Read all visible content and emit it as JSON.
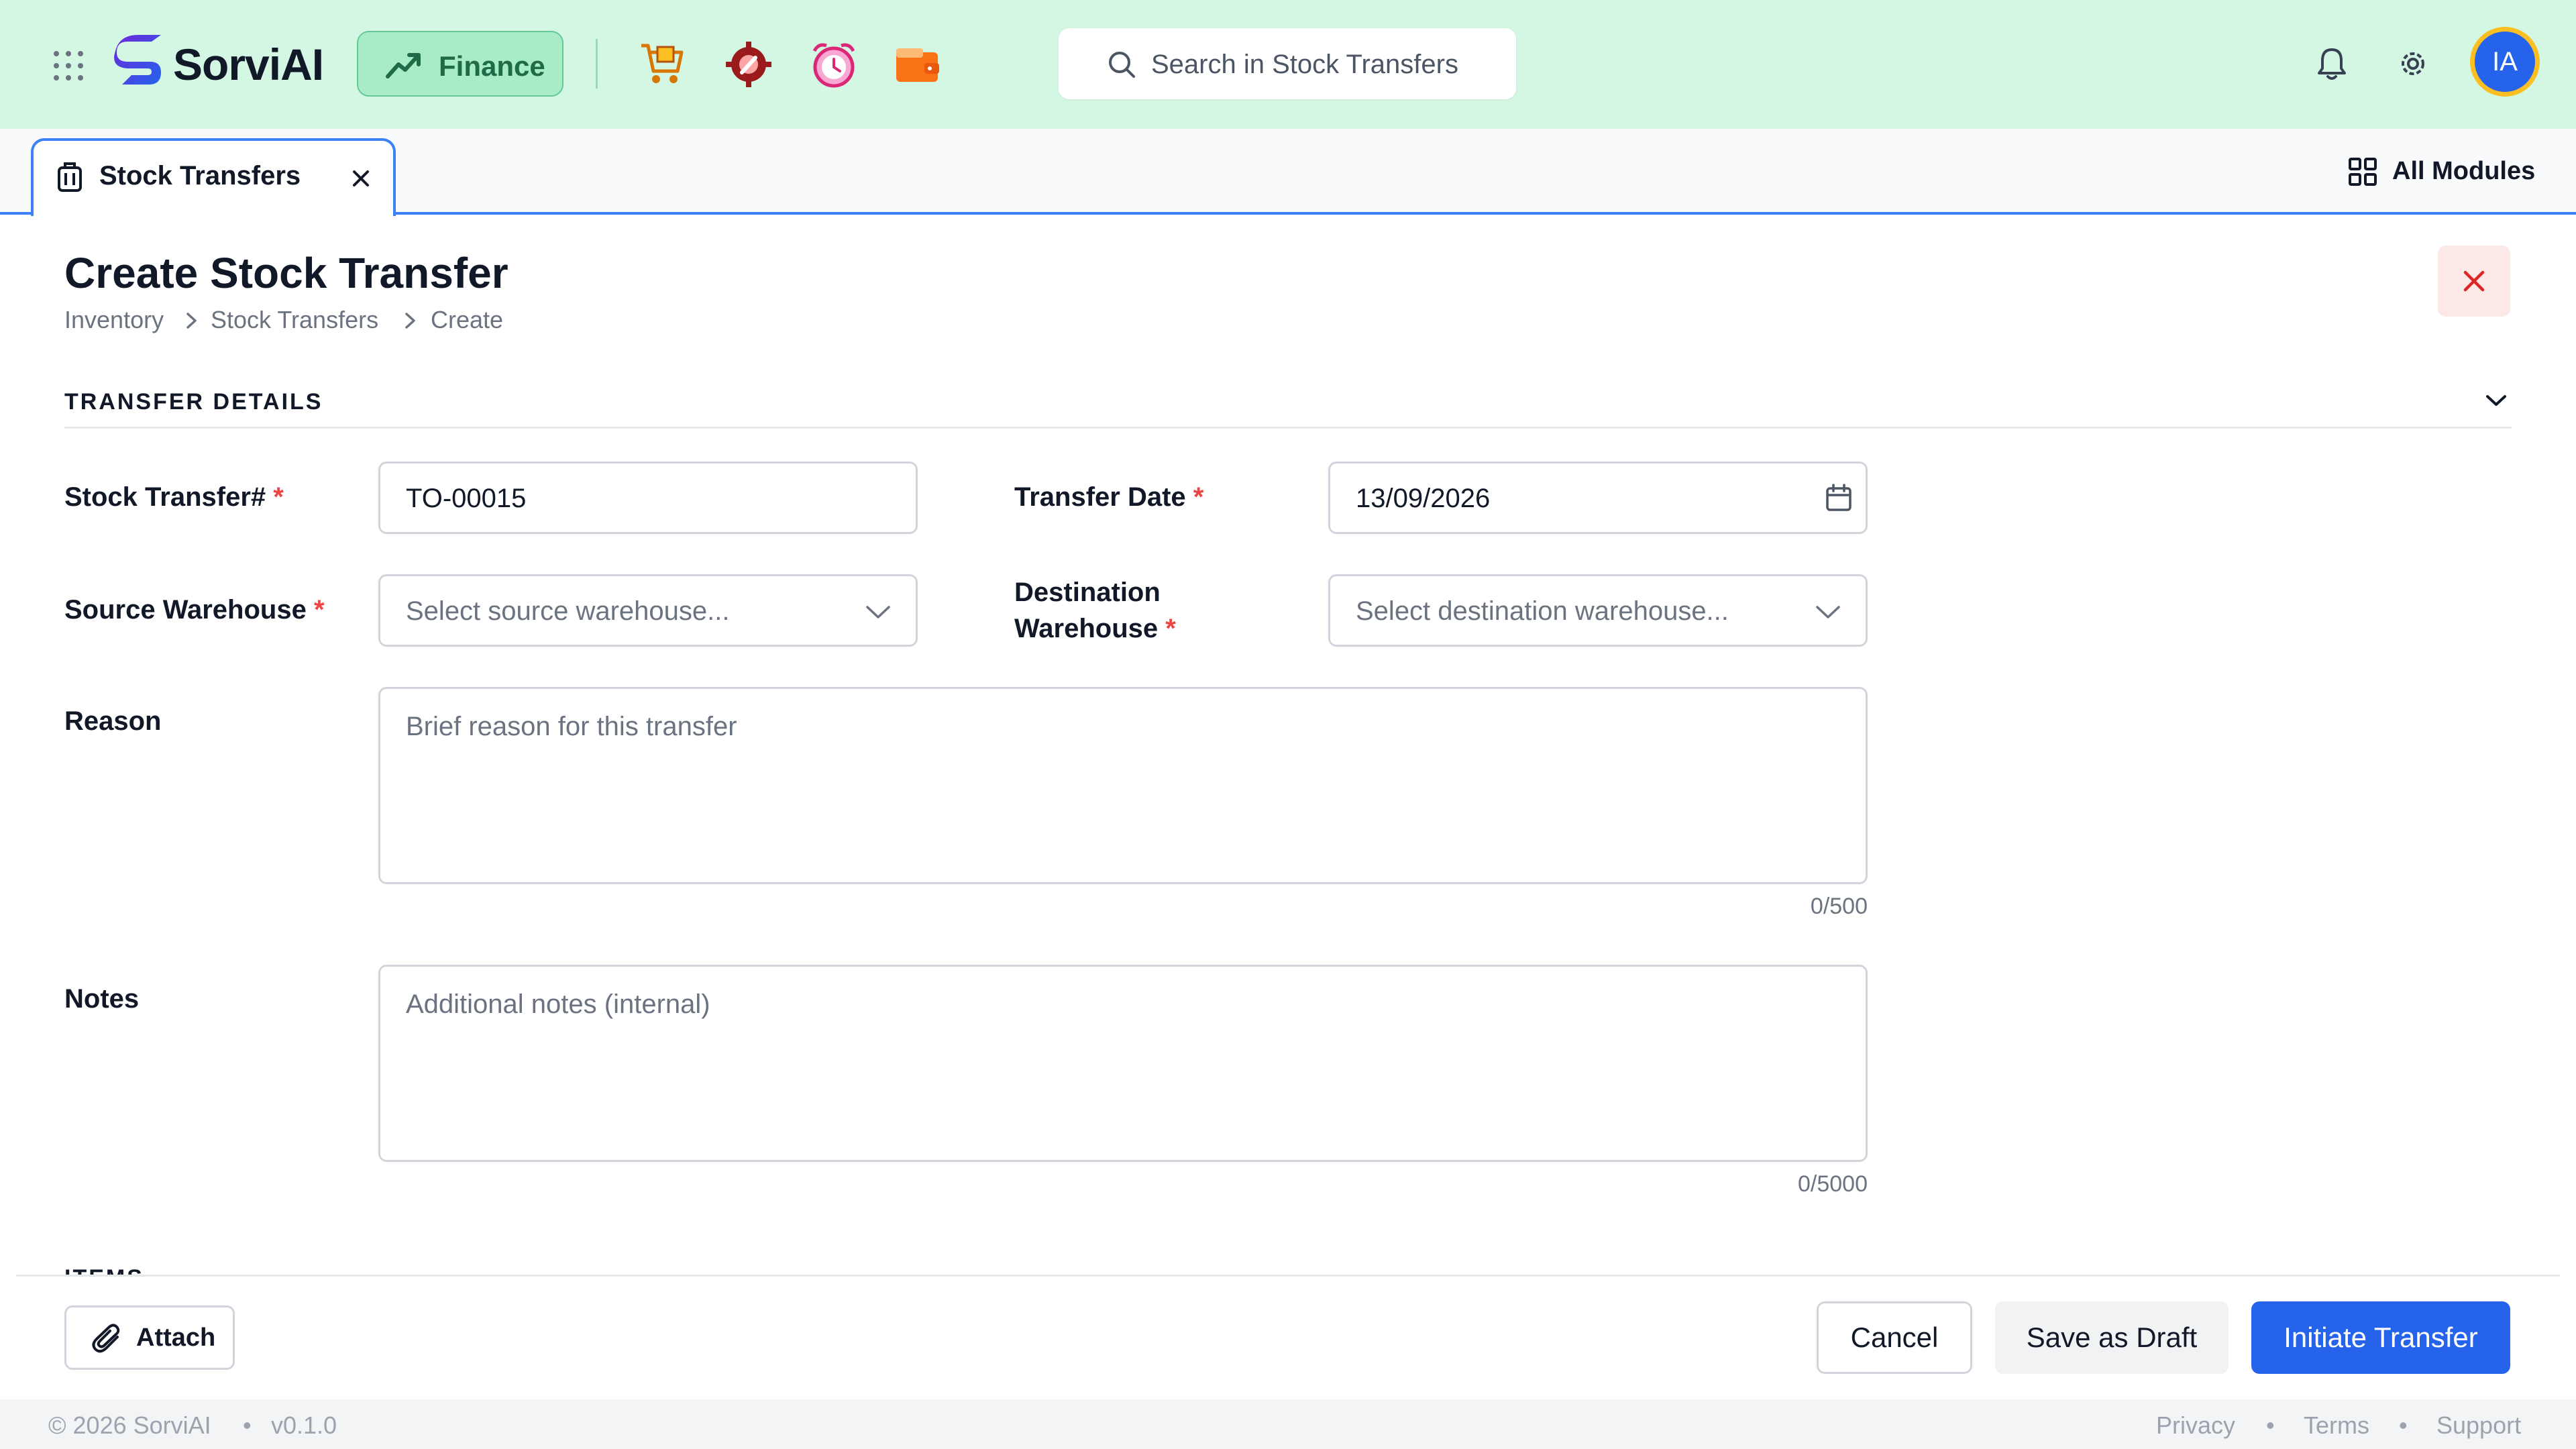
{
  "header": {
    "brand": "SorviAI",
    "module": "Finance",
    "search_placeholder": "Search in Stock Transfers",
    "avatar_initials": "IA"
  },
  "tabs": {
    "active_tab": "Stock Transfers",
    "all_modules": "All Modules"
  },
  "page": {
    "title": "Create Stock Transfer",
    "breadcrumb": [
      "Inventory",
      "Stock Transfers",
      "Create"
    ]
  },
  "section": {
    "title": "TRANSFER DETAILS"
  },
  "form": {
    "stock_transfer_label": "Stock Transfer#",
    "stock_transfer_value": "TO-00015",
    "transfer_date_label": "Transfer Date",
    "transfer_date_value": "13/09/2026",
    "source_label": "Source Warehouse",
    "source_placeholder": "Select source warehouse...",
    "destination_label_line1": "Destination",
    "destination_label_line2": "Warehouse",
    "destination_placeholder": "Select destination warehouse...",
    "reason_label": "Reason",
    "reason_placeholder": "Brief reason for this transfer",
    "reason_counter": "0/500",
    "notes_label": "Notes",
    "notes_placeholder": "Additional notes (internal)",
    "notes_counter": "0/5000",
    "required_mark": "*"
  },
  "next_section": "ITEMS",
  "actions": {
    "attach": "Attach",
    "cancel": "Cancel",
    "save_draft": "Save as Draft",
    "initiate": "Initiate Transfer"
  },
  "footer": {
    "copyright": "© 2026 SorviAI",
    "version": "v0.1.0",
    "privacy": "Privacy",
    "terms": "Terms",
    "support": "Support",
    "separator": "•"
  },
  "colors": {
    "header_bg": "#d4f7e3",
    "primary": "#2563eb",
    "required": "#ef4444",
    "close_bg": "#fde8e8"
  }
}
